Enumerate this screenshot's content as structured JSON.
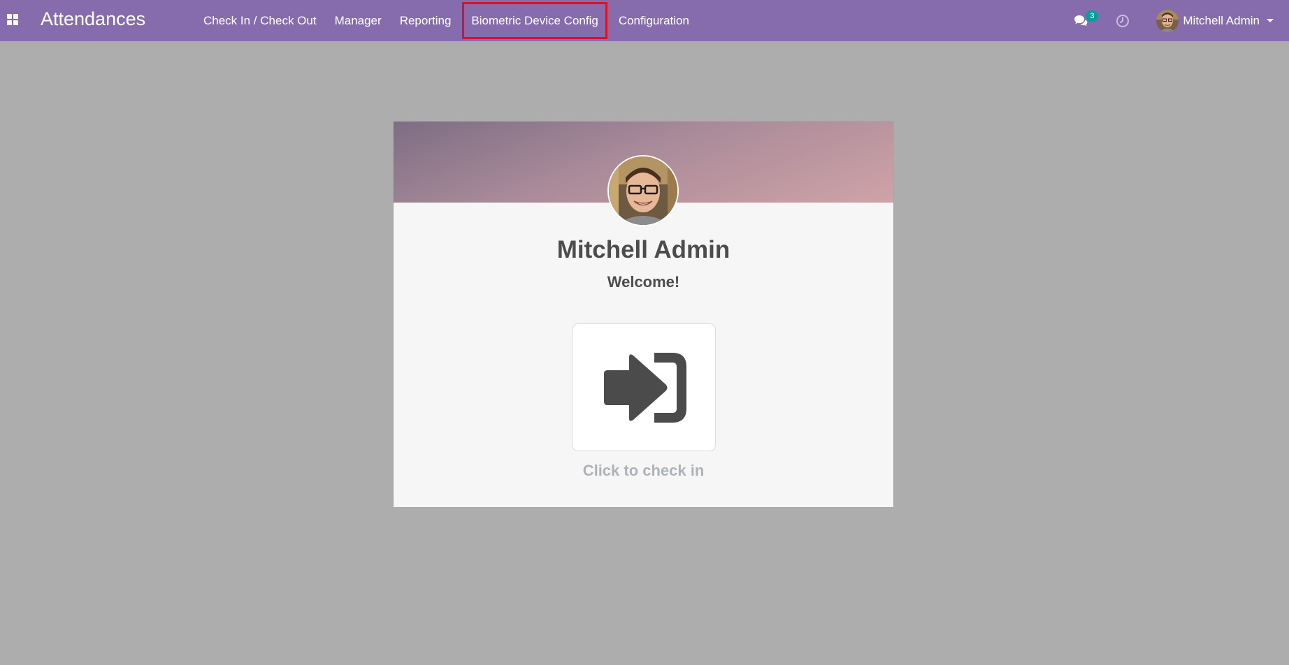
{
  "app": {
    "title": "Attendances"
  },
  "menu": {
    "items": [
      {
        "label": "Check In / Check Out"
      },
      {
        "label": "Manager"
      },
      {
        "label": "Reporting"
      },
      {
        "label": "Biometric Device Config"
      },
      {
        "label": "Configuration"
      }
    ]
  },
  "navbar": {
    "chat_icon": "comments-icon",
    "chat_count": "3",
    "activity_icon": "clock-icon",
    "user_name": "Mitchell Admin"
  },
  "card": {
    "employee_name": "Mitchell Admin",
    "greeting": "Welcome!",
    "checkin_icon": "sign-in-icon",
    "checkin_label": "Click to check in"
  },
  "colors": {
    "navbar": "#876cad",
    "highlight": "#e0101f",
    "badge": "#00a09d",
    "background": "#adadad"
  }
}
